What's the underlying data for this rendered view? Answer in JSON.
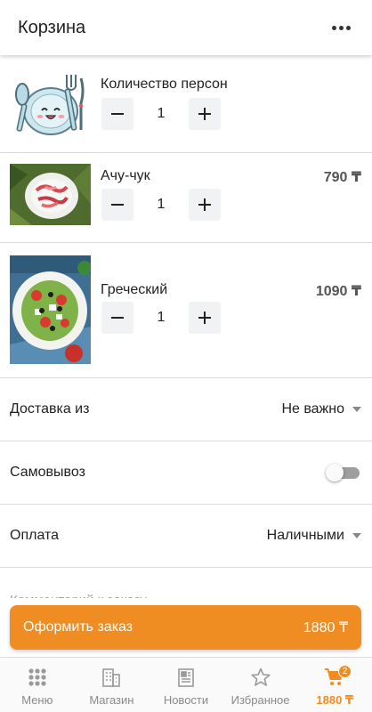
{
  "header": {
    "title": "Корзина"
  },
  "persons": {
    "label": "Количество персон",
    "quantity": "1"
  },
  "items": [
    {
      "name": "Ачу-чук",
      "price": "790 ₸",
      "quantity": "1"
    },
    {
      "name": "Греческий",
      "price": "1090 ₸",
      "quantity": "1"
    }
  ],
  "delivery": {
    "label": "Доставка из",
    "value": "Не важно"
  },
  "pickup": {
    "label": "Самовывоз",
    "enabled": false
  },
  "payment": {
    "label": "Оплата",
    "value": "Наличными"
  },
  "comment": {
    "placeholder": "Комментарий к заказу"
  },
  "checkout": {
    "label": "Оформить заказ",
    "total": "1880 ₸"
  },
  "tabs": [
    {
      "label": "Меню",
      "icon": "grid-icon"
    },
    {
      "label": "Магазин",
      "icon": "building-icon"
    },
    {
      "label": "Новости",
      "icon": "newspaper-icon"
    },
    {
      "label": "Избранное",
      "icon": "star-icon"
    },
    {
      "label": "1880 ₸",
      "icon": "cart-icon",
      "badge": "2",
      "active": true
    }
  ],
  "colors": {
    "accent": "#ef8c22",
    "text": "#222222",
    "muted": "#8a8a8a",
    "divider": "#dcdcdc"
  }
}
